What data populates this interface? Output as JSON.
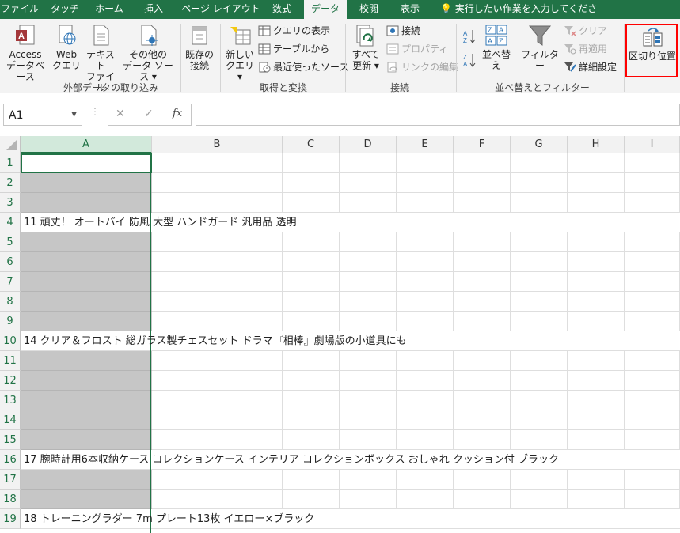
{
  "tabs": [
    {
      "label": "ファイル",
      "active": false
    },
    {
      "label": "タッチ",
      "active": false
    },
    {
      "label": "ホーム",
      "active": false
    },
    {
      "label": "挿入",
      "active": false
    },
    {
      "label": "ページ レイアウト",
      "active": false
    },
    {
      "label": "数式",
      "active": false
    },
    {
      "label": "データ",
      "active": true
    },
    {
      "label": "校閲",
      "active": false
    },
    {
      "label": "表示",
      "active": false
    }
  ],
  "tell_me": "実行したい作業を入力してください",
  "ribbon": {
    "external": {
      "access_l1": "Access",
      "access_l2": "データベース",
      "web_l1": "Web",
      "web_l2": "クエリ",
      "text_l1": "テキスト",
      "text_l2": "ファイル",
      "other_l1": "その他の",
      "other_l2": "データ ソース ▾",
      "existing_l1": "既存の",
      "existing_l2": "接続",
      "group": "外部データの取り込み"
    },
    "transform": {
      "newq_l1": "新しい",
      "newq_l2": "クエリ ▾",
      "show_queries": "クエリの表示",
      "from_table": "テーブルから",
      "recent_sources": "最近使ったソース",
      "group": "取得と変換"
    },
    "connections": {
      "refresh_l1": "すべて",
      "refresh_l2": "更新 ▾",
      "connections": "接続",
      "properties": "プロパティ",
      "edit_links": "リンクの編集",
      "group": "接続"
    },
    "sort_filter": {
      "sort": "並べ替え",
      "filter": "フィルター",
      "clear": "クリア",
      "reapply": "再適用",
      "advanced": "詳細設定",
      "group": "並べ替えとフィルター"
    },
    "tools": {
      "text_to_columns": "区切り位置"
    }
  },
  "formula_bar": {
    "name_box": "A1",
    "cancel": "✕",
    "enter": "✓",
    "fx": "fx",
    "value": ""
  },
  "columns": [
    "A",
    "B",
    "C",
    "D",
    "E",
    "F",
    "G",
    "H",
    "I"
  ],
  "rows": [
    "1",
    "2",
    "3",
    "4",
    "5",
    "6",
    "7",
    "8",
    "9",
    "10",
    "11",
    "12",
    "13",
    "14",
    "15",
    "16",
    "17",
    "18",
    "19"
  ],
  "cells": {
    "r4": "11 頑丈！ オートバイ 防風 大型 ハンドガード 汎用品 透明",
    "r10": "14 クリア＆フロスト 総ガラス製チェスセット ドラマ『相棒』劇場版の小道具にも",
    "r16": "17 腕時計用6本収納ケース コレクションケース インテリア コレクションボックス おしゃれ クッション付 ブラック",
    "r19": "18 トレーニングラダー 7m プレート13枚 イエロー×ブラック"
  }
}
